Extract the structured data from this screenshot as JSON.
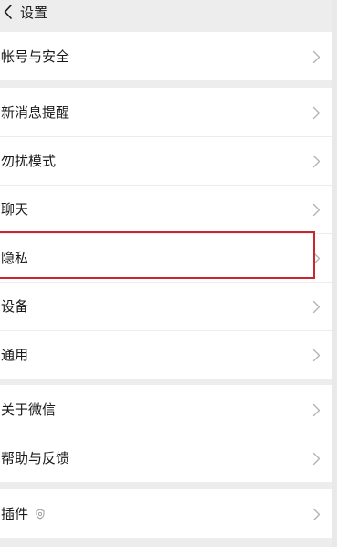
{
  "header": {
    "title": "设置"
  },
  "groups": [
    {
      "items": [
        {
          "label": "帐号与安全"
        }
      ]
    },
    {
      "items": [
        {
          "label": "新消息提醒"
        },
        {
          "label": "勿扰模式"
        },
        {
          "label": "聊天"
        },
        {
          "label": "隐私"
        },
        {
          "label": "设备"
        },
        {
          "label": "通用"
        }
      ]
    },
    {
      "items": [
        {
          "label": "关于微信"
        },
        {
          "label": "帮助与反馈"
        }
      ]
    },
    {
      "items": [
        {
          "label": "插件"
        }
      ]
    }
  ],
  "highlighted_item": "隐私",
  "colors": {
    "background": "#ededed",
    "card": "#ffffff",
    "highlight": "#c9272d",
    "chevron": "#b2b2b2"
  },
  "icons": {
    "back": "chevron-left-icon",
    "row_arrow": "chevron-right-icon",
    "plugin": "plugin-shield-icon"
  }
}
